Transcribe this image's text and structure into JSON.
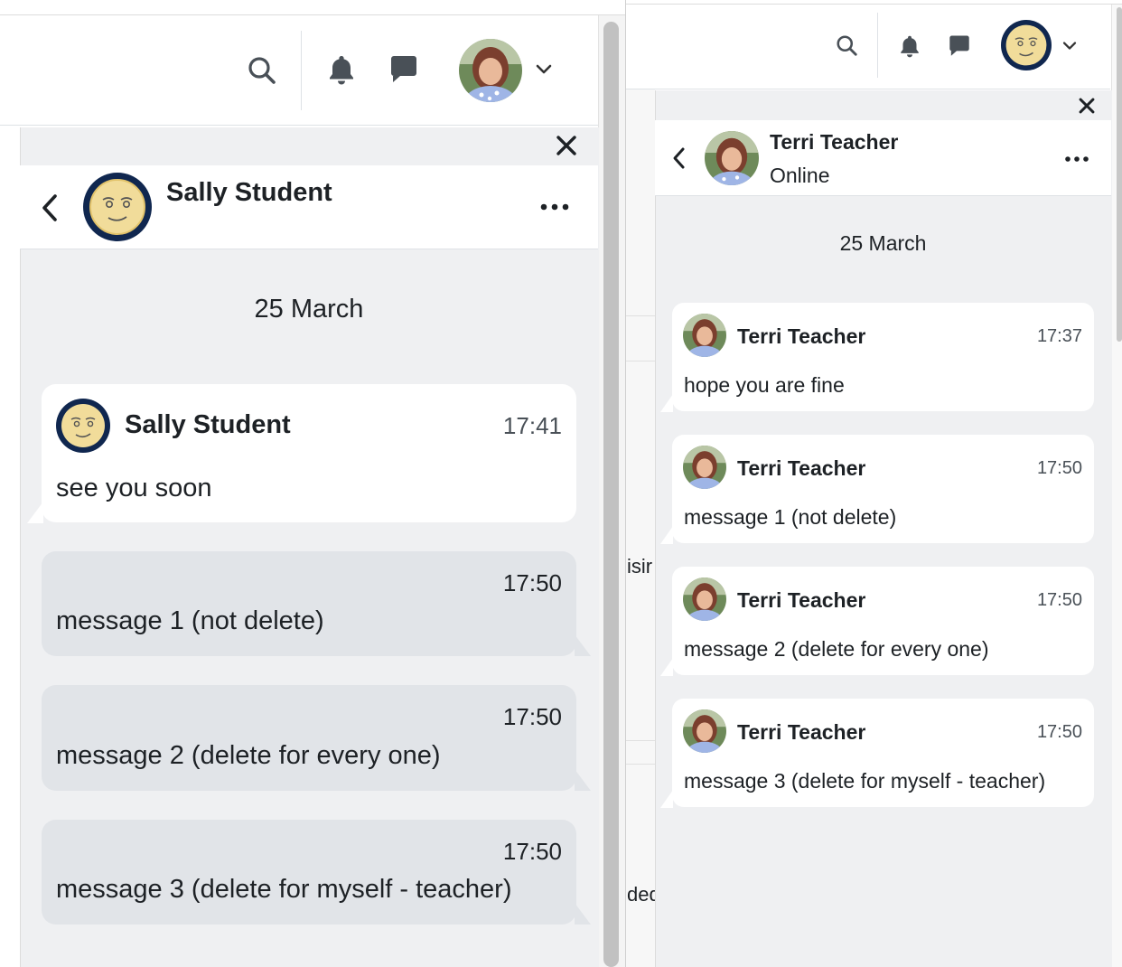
{
  "left": {
    "conversation": {
      "contact_name": "Sally Student",
      "date_label": "25 March"
    },
    "messages": [
      {
        "author": "Sally Student",
        "time": "17:41",
        "text": "see you soon"
      },
      {
        "time": "17:50",
        "text": "message 1 (not delete)"
      },
      {
        "time": "17:50",
        "text": "message 2 (delete for every one)"
      },
      {
        "time": "17:50",
        "text": "message 3 (delete for myself - teacher)"
      }
    ]
  },
  "right": {
    "page_fragments": [
      "isir",
      "ded"
    ],
    "conversation": {
      "contact_name": "Terri Teacher",
      "contact_status": "Online",
      "date_label": "25 March"
    },
    "messages": [
      {
        "author": "Terri Teacher",
        "time": "17:37",
        "text": "hope you are fine"
      },
      {
        "author": "Terri Teacher",
        "time": "17:50",
        "text": "message 1 (not delete)"
      },
      {
        "author": "Terri Teacher",
        "time": "17:50",
        "text": "message 2 (delete for every one)"
      },
      {
        "author": "Terri Teacher",
        "time": "17:50",
        "text": "message 3 (delete for myself - teacher)"
      }
    ]
  },
  "icons": {
    "search": "search-icon",
    "notifications": "bell-icon",
    "messages": "chat-bubble-icon",
    "user_menu": "chevron-down-icon",
    "close": "close-icon",
    "back": "chevron-left-icon",
    "more": "ellipsis-icon"
  },
  "colors": {
    "drawer_bg": "#eff0f2",
    "sent_bubble": "#e1e4e8",
    "received_bubble": "#ffffff",
    "avatar_ring": "#10274f",
    "text": "#1d2125"
  }
}
